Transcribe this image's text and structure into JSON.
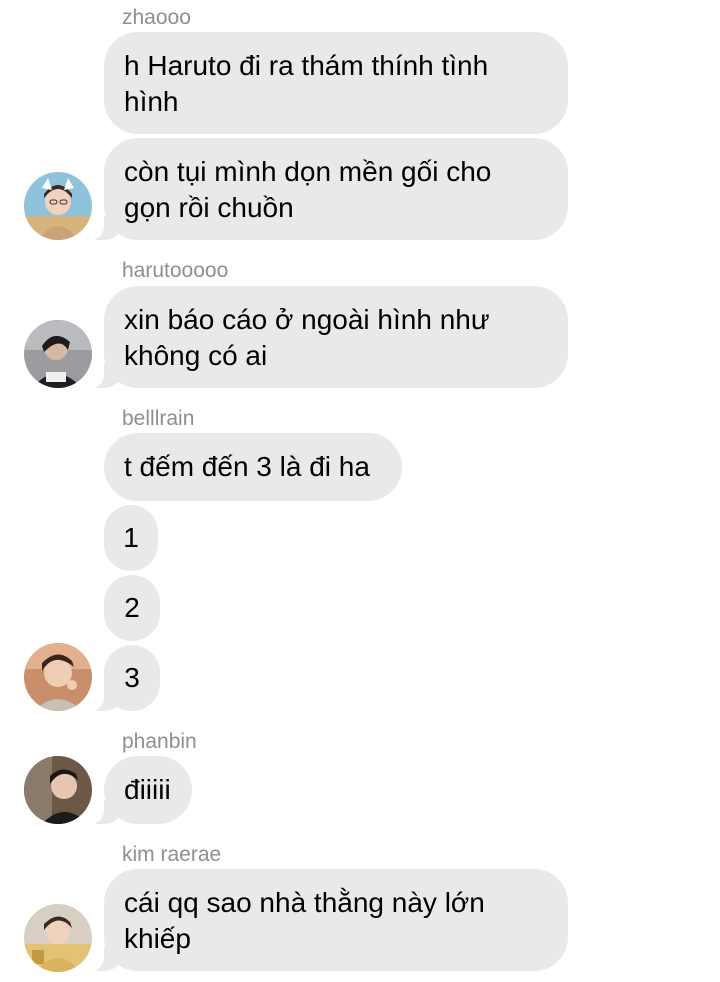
{
  "chat": {
    "groups": [
      {
        "sender": "zhaooo",
        "messages": [
          {
            "line1": "h Haruto đi ra thám thính tình",
            "line2": "hình"
          },
          {
            "line1": "còn tụi mình dọn mền gối cho",
            "line2": "gọn rồi chuồn"
          }
        ]
      },
      {
        "sender": "harutooooo",
        "messages": [
          {
            "line1": "xin báo cáo ở ngoài hình như",
            "line2": "không có ai"
          }
        ]
      },
      {
        "sender": "belllrain",
        "messages": [
          {
            "line1": "t đếm đến 3 là đi ha"
          },
          {
            "line1": "1"
          },
          {
            "line1": "2"
          },
          {
            "line1": "3"
          }
        ]
      },
      {
        "sender": "phanbin",
        "messages": [
          {
            "line1": "điiiii"
          }
        ]
      },
      {
        "sender": "kim raerae",
        "messages": [
          {
            "line1": "cái qq sao nhà thằng này lớn",
            "line2": "khiếp"
          }
        ]
      }
    ]
  },
  "colors": {
    "bubble": "#e9e9eb",
    "sender_name": "#8e8e93",
    "text": "#000000",
    "background": "#ffffff"
  },
  "icons": [
    "avatar-zhaooo-icon",
    "avatar-harutooooo-icon",
    "avatar-belllrain-icon",
    "avatar-phanbin-icon",
    "avatar-kim-raerae-icon"
  ]
}
